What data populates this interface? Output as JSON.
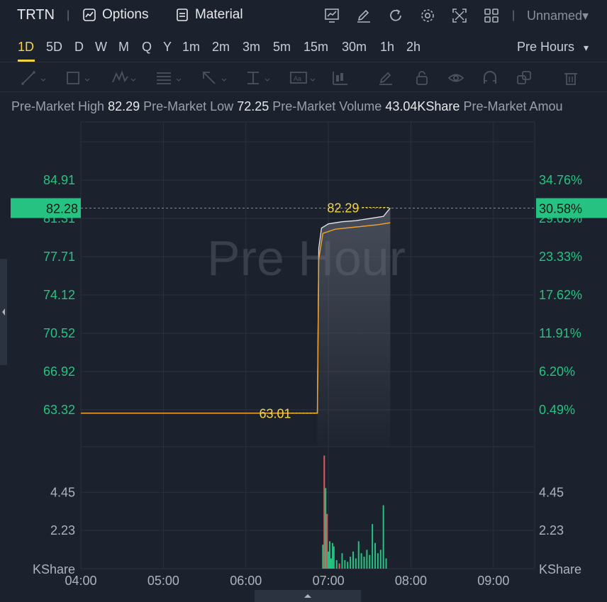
{
  "topbar": {
    "symbol": "TRTN",
    "separator": "|",
    "options_label": "Options",
    "material_label": "Material",
    "separator2": "|",
    "layout_name": "Unnamed▾"
  },
  "periods": [
    {
      "label": "1D",
      "active": true
    },
    {
      "label": "5D"
    },
    {
      "label": "D"
    },
    {
      "label": "W"
    },
    {
      "label": "M"
    },
    {
      "label": "Q"
    },
    {
      "label": "Y"
    },
    {
      "label": "1m"
    },
    {
      "label": "2m"
    },
    {
      "label": "3m"
    },
    {
      "label": "5m"
    },
    {
      "label": "15m"
    },
    {
      "label": "30m"
    },
    {
      "label": "1h"
    },
    {
      "label": "2h"
    }
  ],
  "session_select": {
    "value": "Pre Hours",
    "caret": "▾"
  },
  "info": {
    "high_label": "Pre-Market High",
    "high_value": "82.29",
    "low_label": "Pre-Market Low",
    "low_value": "72.25",
    "volume_label": "Pre-Market Volume",
    "volume_value": "43.04KShare",
    "amount_label": "Pre-Market Amou"
  },
  "watermark": "Pre Hour",
  "colors": {
    "up": "#26c281",
    "down": "#e05a5a",
    "price_line": "#f0a030",
    "highlight": "#f5d442",
    "background": "#1c222d",
    "grid": "#2a313d"
  },
  "chart_data": {
    "type": "line",
    "x_ticks": [
      "04:00",
      "05:00",
      "06:00",
      "07:00",
      "08:00",
      "09:00"
    ],
    "y_left_ticks": [
      "84.91",
      "81.31",
      "77.71",
      "74.12",
      "70.52",
      "66.92",
      "63.32"
    ],
    "y_right_ticks": [
      "34.76%",
      "29.03%",
      "23.33%",
      "17.62%",
      "11.91%",
      "6.20%",
      "0.49%"
    ],
    "ylim": [
      63.32,
      84.91
    ],
    "current_price": "82.28",
    "current_change": "30.58%",
    "high_annotation": "82.29",
    "low_annotation": "63.01",
    "price_series": [
      {
        "t": "04:00",
        "price": 63.01
      },
      {
        "t": "06:52",
        "price": 63.01
      },
      {
        "t": "06:53",
        "price": 78.5
      },
      {
        "t": "06:55",
        "price": 80.4
      },
      {
        "t": "07:00",
        "price": 80.8
      },
      {
        "t": "07:10",
        "price": 81.0
      },
      {
        "t": "07:20",
        "price": 81.1
      },
      {
        "t": "07:30",
        "price": 81.3
      },
      {
        "t": "07:40",
        "price": 81.5
      },
      {
        "t": "07:45",
        "price": 82.29
      }
    ],
    "avg_series": [
      {
        "t": "04:00",
        "price": 63.01
      },
      {
        "t": "06:52",
        "price": 63.01
      },
      {
        "t": "06:53",
        "price": 77.5
      },
      {
        "t": "06:56",
        "price": 79.9
      },
      {
        "t": "07:05",
        "price": 80.3
      },
      {
        "t": "07:20",
        "price": 80.5
      },
      {
        "t": "07:35",
        "price": 80.7
      },
      {
        "t": "07:45",
        "price": 80.9
      }
    ],
    "volume_unit": "KShare",
    "volume_ticks": [
      "4.45",
      "2.23"
    ],
    "volume_max": 6.7,
    "volume_bars": [
      {
        "t": "06:56",
        "v": 1.4,
        "dir": "up"
      },
      {
        "t": "06:57",
        "v": 6.6,
        "dir": "down"
      },
      {
        "t": "06:58",
        "v": 4.7,
        "dir": "up"
      },
      {
        "t": "06:59",
        "v": 3.2,
        "dir": "down"
      },
      {
        "t": "07:00",
        "v": 1.0,
        "dir": "up"
      },
      {
        "t": "07:01",
        "v": 1.6,
        "dir": "up"
      },
      {
        "t": "07:02",
        "v": 0.6,
        "dir": "up"
      },
      {
        "t": "07:03",
        "v": 1.5,
        "dir": "up"
      },
      {
        "t": "07:04",
        "v": 1.3,
        "dir": "up"
      },
      {
        "t": "07:06",
        "v": 0.5,
        "dir": "up"
      },
      {
        "t": "07:08",
        "v": 0.3,
        "dir": "down"
      },
      {
        "t": "07:10",
        "v": 0.9,
        "dir": "up"
      },
      {
        "t": "07:12",
        "v": 0.5,
        "dir": "up"
      },
      {
        "t": "07:14",
        "v": 0.4,
        "dir": "up"
      },
      {
        "t": "07:16",
        "v": 0.7,
        "dir": "up"
      },
      {
        "t": "07:18",
        "v": 1.0,
        "dir": "up"
      },
      {
        "t": "07:20",
        "v": 0.6,
        "dir": "up"
      },
      {
        "t": "07:22",
        "v": 1.6,
        "dir": "up"
      },
      {
        "t": "07:24",
        "v": 0.9,
        "dir": "up"
      },
      {
        "t": "07:26",
        "v": 0.7,
        "dir": "up"
      },
      {
        "t": "07:28",
        "v": 1.1,
        "dir": "up"
      },
      {
        "t": "07:30",
        "v": 0.8,
        "dir": "up"
      },
      {
        "t": "07:32",
        "v": 2.6,
        "dir": "up"
      },
      {
        "t": "07:34",
        "v": 1.5,
        "dir": "up"
      },
      {
        "t": "07:36",
        "v": 0.9,
        "dir": "up"
      },
      {
        "t": "07:38",
        "v": 1.1,
        "dir": "up"
      },
      {
        "t": "07:40",
        "v": 3.7,
        "dir": "up"
      },
      {
        "t": "07:42",
        "v": 0.6,
        "dir": "up"
      }
    ]
  }
}
